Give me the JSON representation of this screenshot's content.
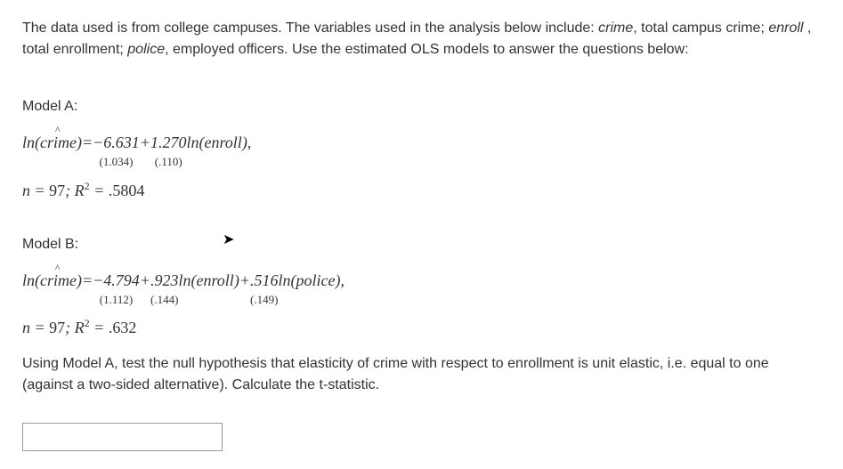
{
  "intro": {
    "pre1": "The data used is from college campuses. The variables used in the analysis below include: ",
    "var1": "crime",
    "def1": ", total campus crime; ",
    "var2": "enroll",
    "def2": " , total enrollment; ",
    "var3": "police",
    "def3": ", employed officers. Use the estimated OLS models to answer the questions below:"
  },
  "modelA": {
    "label": "Model A:",
    "lhs_ln": "ln",
    "lhs_open": "(",
    "lhs_var": "crime",
    "lhs_close": ")",
    "eq": " = ",
    "c0": "−6.631",
    "se0": "(1.034)",
    "plus1": " + ",
    "c1": "1.270",
    "se1": "(.110)",
    "t1_ln": "ln",
    "t1_open": "(",
    "t1_var": "enroll",
    "t1_close": "),",
    "stats_n": "n",
    "stats_eq1": " = ",
    "stats_nval": "97",
    "stats_sep": "; ",
    "stats_R": "R",
    "stats_sup": "2",
    "stats_eq2": " = ",
    "stats_r2": ".5804"
  },
  "modelB": {
    "label": "Model B:",
    "lhs_ln": "ln",
    "lhs_open": "(",
    "lhs_var": "crime",
    "lhs_close": ")",
    "eq": " = ",
    "c0": "−4.794",
    "se0": "(1.112)",
    "plus1": " + ",
    "c1": ".923",
    "se1": "(.144)",
    "t1_ln": "ln",
    "t1_open": "(",
    "t1_var": "enroll",
    "t1_close": ")",
    "plus2": " + ",
    "c2": ".516",
    "se2": "(.149)",
    "t2_ln": "ln",
    "t2_open": "(",
    "t2_var": "police",
    "t2_close": "),",
    "stats_n": "n",
    "stats_eq1": " = ",
    "stats_nval": "97",
    "stats_sep": "; ",
    "stats_R": "R",
    "stats_sup": "2",
    "stats_eq2": " = ",
    "stats_r2": ".632"
  },
  "question": {
    "text": "Using Model A, test the null hypothesis that elasticity of crime with respect to enrollment is unit elastic, i.e. equal to one (against a two-sided alternative). Calculate the t-statistic."
  },
  "answer": {
    "value": ""
  }
}
